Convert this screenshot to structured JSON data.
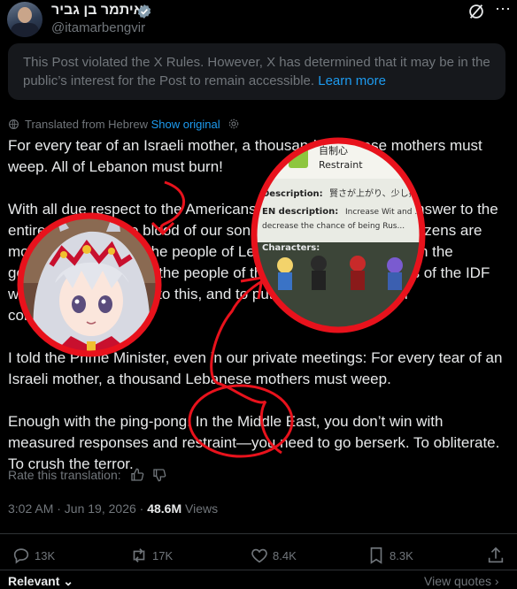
{
  "header": {
    "name": "איתמר בן גביר",
    "handle": "@itamarbengvir",
    "more_icon": "⋯"
  },
  "notice": {
    "text": "This Post violated the X Rules. However, X has determined that it may be in the public’s interest for the Post to remain accessible.",
    "link": "Learn more"
  },
  "translation": {
    "label": "Translated from Hebrew",
    "show_original": "Show original"
  },
  "post": {
    "paragraphs": [
      "For every tear of an Israeli mother, a thousand Lebanese mothers must weep. All of Lebanon must burn!",
      "With all due respect to the Americans and the world, we will answer to the entire region for the blood of our sons and our citizens. The citizens are more important than the people of Lebanon must burn. I call on the government to protect the people of the north and the soldiers of the IDF with total commitment to this, and to put it above every other consideration.",
      "I told the Prime Minister, even in our private meetings: For every tear of an Israeli mother, a thousand Lebanese mothers must weep.",
      "Enough with the ping-pong. In the Middle East, you don’t win with measured responses and restraint—you need to go berserk. To obliterate. To crush the terror."
    ]
  },
  "rate": {
    "label": "Rate this translation:"
  },
  "meta": {
    "time": "3:02 AM · Jun 19, 2026 · ",
    "views_count": "48.6M",
    "views_label": " Views"
  },
  "actions": {
    "replies": "13K",
    "reposts": "17K",
    "likes": "8.4K",
    "bookmarks": "8.3K"
  },
  "footer": {
    "sort": "Relevant",
    "view_quotes": "View quotes"
  },
  "overlay_card": {
    "title_jp": "自制心",
    "title_en": "Restraint",
    "desc_label": "Description:",
    "desc_value": "賢さが上がり、少し抑",
    "en_label": "EN description:",
    "en_value": "Increase Wit and ...r to the",
    "en_value2": "decrease the chance of being Rus...",
    "chars_label": "Characters:"
  },
  "colors": {
    "accent": "#1d9bf0",
    "circle": "#e8121c",
    "bg": "#000000"
  }
}
